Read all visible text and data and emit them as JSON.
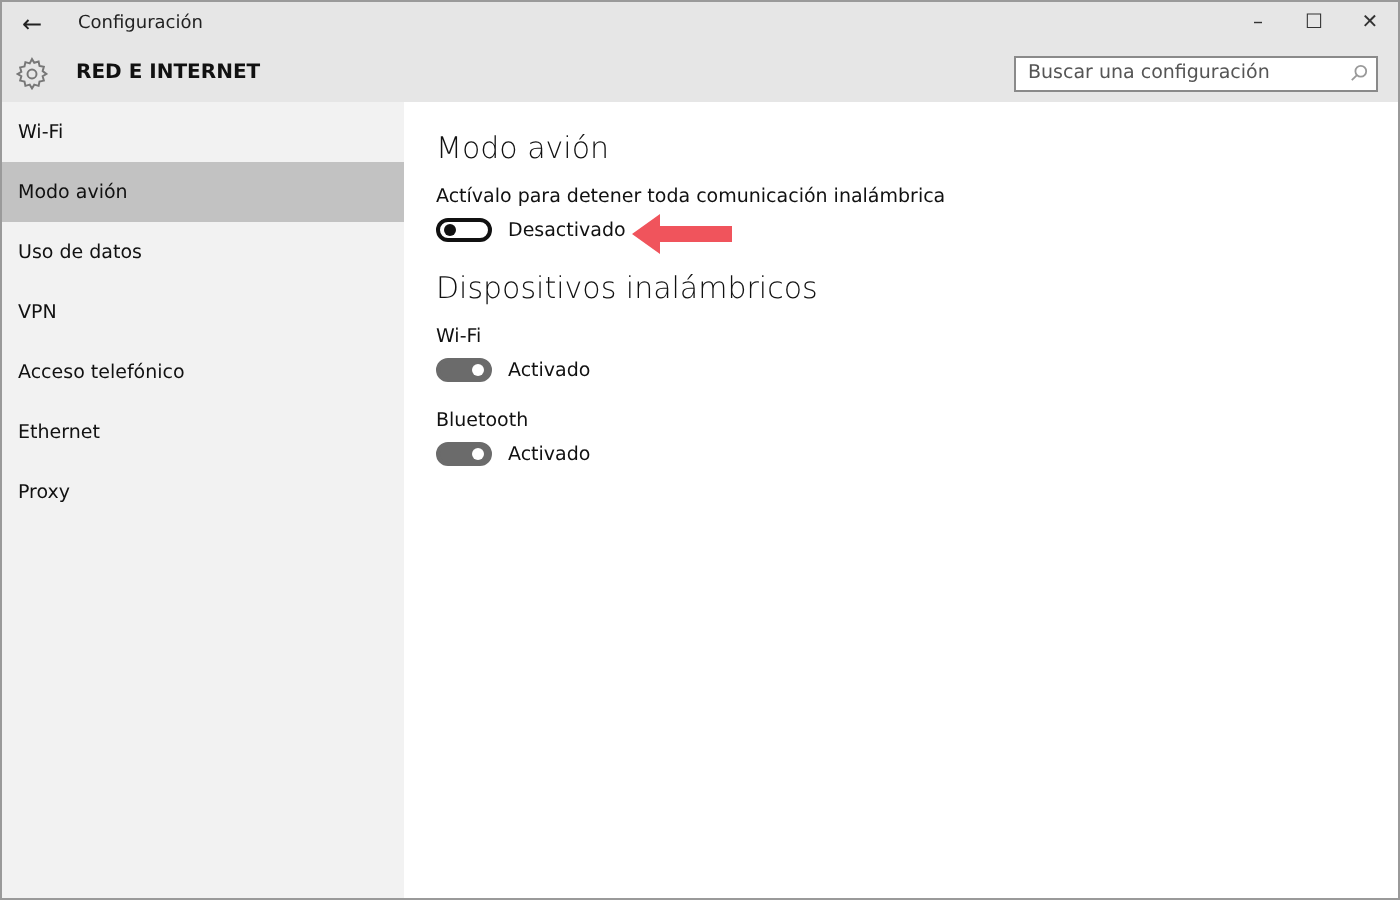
{
  "window": {
    "title": "Configuración",
    "back": "←",
    "controls": [
      "–",
      "☐",
      "✕"
    ]
  },
  "header": {
    "title": "RED E INTERNET",
    "search": {
      "placeholder": "Buscar una configuración"
    }
  },
  "sidebar": {
    "items": [
      {
        "label": "Wi-Fi",
        "selected": false
      },
      {
        "label": "Modo avión",
        "selected": true
      },
      {
        "label": "Uso de datos",
        "selected": false
      },
      {
        "label": "VPN",
        "selected": false
      },
      {
        "label": "Acceso telefónico",
        "selected": false
      },
      {
        "label": "Ethernet",
        "selected": false
      },
      {
        "label": "Proxy",
        "selected": false
      }
    ]
  },
  "content": {
    "sections": [
      {
        "title": "Modo avión",
        "settings": [
          {
            "label": "Actívalo para detener toda comunicación inalámbrica",
            "on": false,
            "state": "Desactivado"
          }
        ]
      },
      {
        "title": "Dispositivos inalámbricos",
        "settings": [
          {
            "label": "Wi-Fi",
            "on": true,
            "state": "Activado"
          },
          {
            "label": "Bluetooth",
            "on": true,
            "state": "Activado"
          }
        ]
      }
    ]
  }
}
